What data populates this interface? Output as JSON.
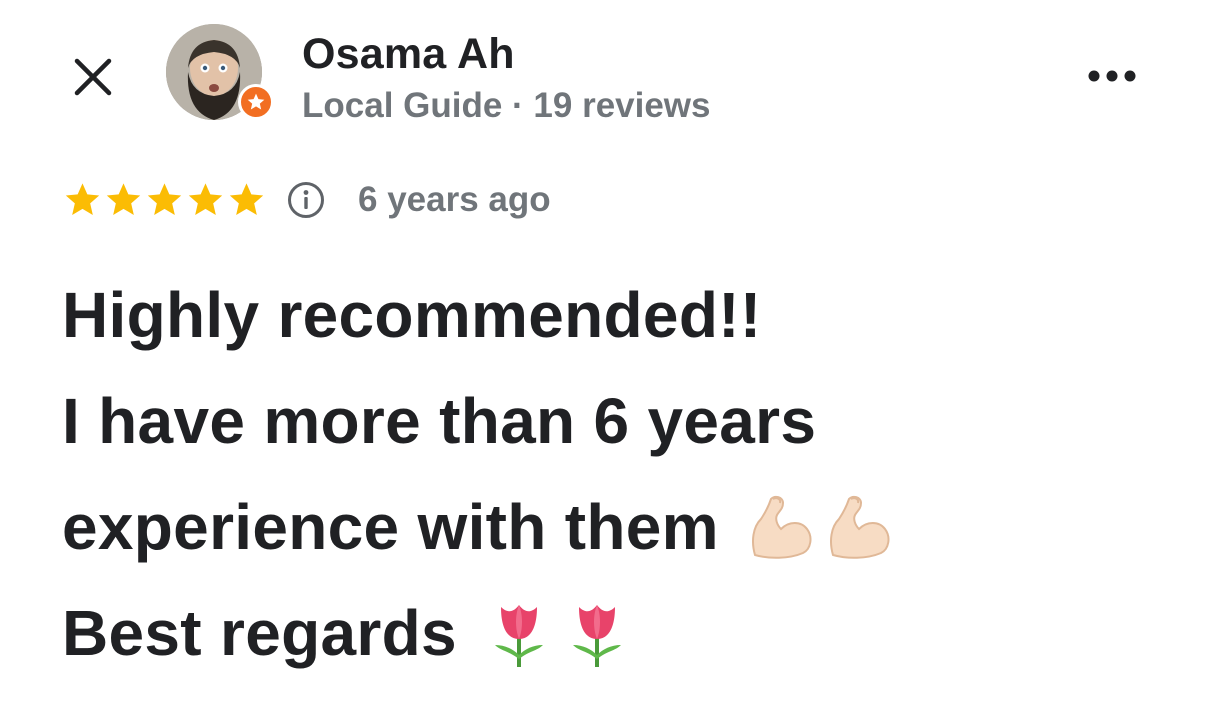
{
  "reviewer": {
    "name": "Osama Ah",
    "meta": "Local Guide · 19 reviews"
  },
  "review": {
    "rating_stars": 5,
    "time": "6 years ago",
    "lines": [
      "Highly recommended!!",
      "I have more than 6 years",
      "experience with them",
      "Best regards"
    ],
    "line_emojis": {
      "line3": [
        "flexed-biceps-icon",
        "flexed-biceps-icon"
      ],
      "line4": [
        "tulip-icon",
        "tulip-icon"
      ]
    }
  },
  "colors": {
    "star": "#fbbc04",
    "badge": "#f26e22",
    "text_primary": "#202124",
    "text_secondary": "#70757a"
  },
  "icons": {
    "close": "close-icon",
    "more": "more-options-icon",
    "info": "info-icon",
    "badge": "local-guide-star-icon"
  }
}
